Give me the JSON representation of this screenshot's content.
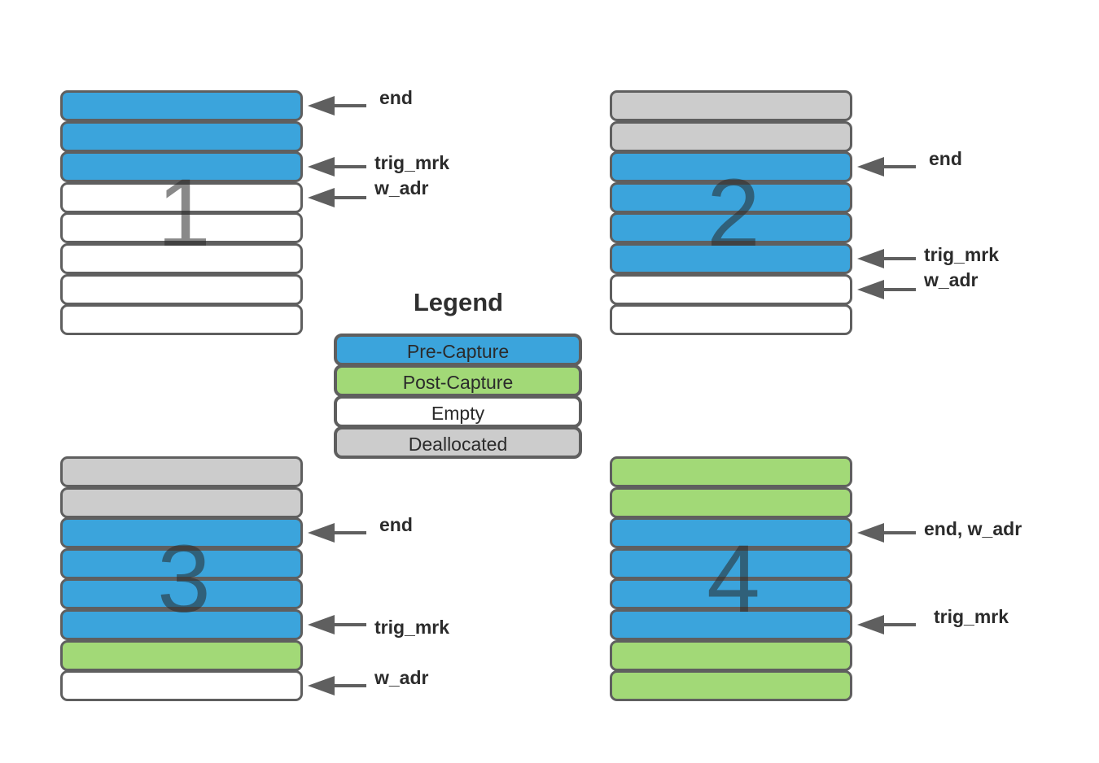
{
  "colors": {
    "pre_capture": "#3ba4dc",
    "post_capture": "#a2d977",
    "empty": "#ffffff",
    "deallocated": "#cccccc",
    "border": "#5f5f5f"
  },
  "legend": {
    "title": "Legend",
    "items": [
      {
        "key": "pre_capture",
        "label": "Pre-Capture"
      },
      {
        "key": "post_capture",
        "label": "Post-Capture"
      },
      {
        "key": "empty",
        "label": "Empty"
      },
      {
        "key": "deallocated",
        "label": "Deallocated"
      }
    ]
  },
  "panels": [
    {
      "number": "1",
      "cells": [
        "pre_capture",
        "pre_capture",
        "pre_capture",
        "empty",
        "empty",
        "empty",
        "empty",
        "empty"
      ],
      "pointers": [
        {
          "label": "end",
          "cell": 0
        },
        {
          "label": "trig_mrk",
          "cell": 2
        },
        {
          "label": "w_adr",
          "cell": 3
        }
      ]
    },
    {
      "number": "2",
      "cells": [
        "deallocated",
        "deallocated",
        "pre_capture",
        "pre_capture",
        "pre_capture",
        "pre_capture",
        "empty",
        "empty"
      ],
      "pointers": [
        {
          "label": "end",
          "cell": 2
        },
        {
          "label": "trig_mrk",
          "cell": 5
        },
        {
          "label": "w_adr",
          "cell": 6
        }
      ]
    },
    {
      "number": "3",
      "cells": [
        "deallocated",
        "deallocated",
        "pre_capture",
        "pre_capture",
        "pre_capture",
        "pre_capture",
        "post_capture",
        "empty"
      ],
      "pointers": [
        {
          "label": "end",
          "cell": 2
        },
        {
          "label": "trig_mrk",
          "cell": 5
        },
        {
          "label": "w_adr",
          "cell": 7
        }
      ]
    },
    {
      "number": "4",
      "cells": [
        "post_capture",
        "post_capture",
        "pre_capture",
        "pre_capture",
        "pre_capture",
        "pre_capture",
        "post_capture",
        "post_capture"
      ],
      "pointers": [
        {
          "label": "end, w_adr",
          "cell": 2
        },
        {
          "label": "trig_mrk",
          "cell": 5
        }
      ]
    }
  ]
}
